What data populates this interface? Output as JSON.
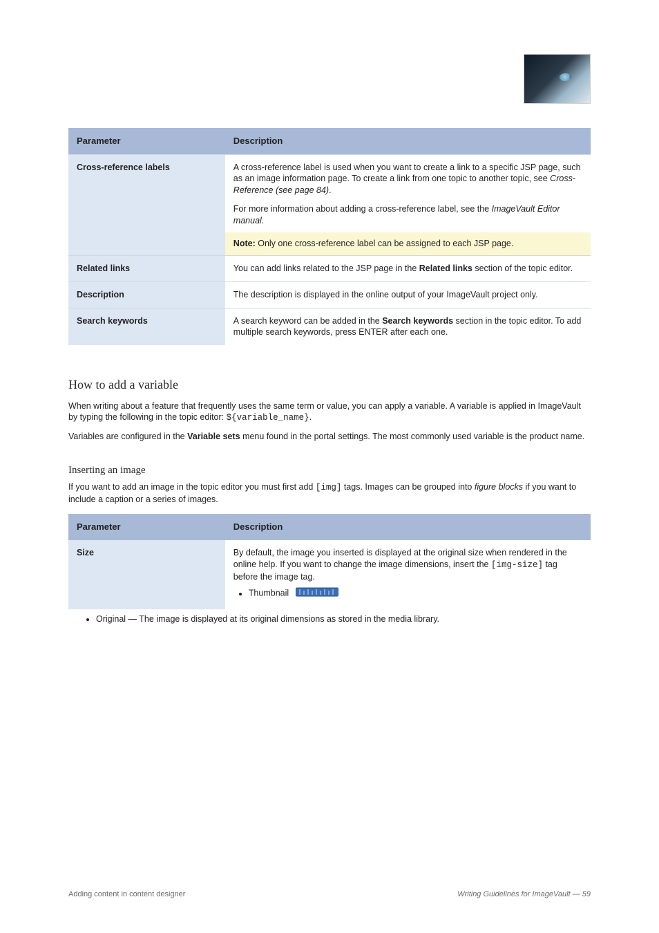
{
  "table1": {
    "headers": [
      "Parameter",
      "Description"
    ],
    "rows": [
      {
        "param": "Cross-reference labels",
        "desc_lead": "A cross-reference label is used when you want to create a link to a specific JSP page, such as an image information page. To create a link from one topic to another topic, see ",
        "xref_link": "Cross-Reference (see page 84)",
        "desc_tail": ".",
        "sub_lead": "For more information about adding a cross-reference label, see the ",
        "sub_link": "ImageVault Editor manual",
        "sub_tail": ".",
        "note_label": "Note:",
        "note_text": " Only one cross-reference label can be assigned to each JSP page."
      },
      {
        "param": "Related links",
        "desc_lead": "You can add links related to the JSP page in the ",
        "desc_bold": "Related links",
        "desc_tail": " section of the topic editor."
      },
      {
        "param": "Description",
        "desc": "The description is displayed in the online output of your ImageVault project only."
      },
      {
        "param": "Search keywords",
        "desc_lead": "A search keyword can be added in the ",
        "desc_bold": "Search keywords",
        "desc_tail2": " section in the topic editor. To add multiple search keywords, press ",
        "desc_key": "ENTER",
        "desc_tail3": " after each one."
      }
    ]
  },
  "section": {
    "heading": "How to add a variable",
    "p1_lead": "When writing about a feature that frequently uses the same term or value, you can apply a variable. A variable is applied in ImageVault by typing the following in the topic editor: ",
    "p1_code": "${variable_name}",
    "p1_tail": ".",
    "p2_lead": "Variables are configured in the ",
    "p2_bold": "Variable sets",
    "p2_tail": " menu found in the portal settings. The most commonly used variable is the product name.",
    "sub_heading": "Inserting an image",
    "p3_lead": "If you want to add an image in the topic editor you must first add ",
    "p3_code": "[img]",
    "p3_mid": " tags. Images can be grouped into ",
    "p3_em": "figure blocks",
    "p3_tail": " if you want to include a caption or a series of images."
  },
  "table2": {
    "headers": [
      "Parameter",
      "Description"
    ],
    "row": {
      "param": "Size",
      "desc_lead_1": "By default, the image you inserted is displayed at the original size when rendered in the online help. If you want to change the image dimensions, insert the ",
      "desc_code": "[img-size]",
      "desc_lead_2": " tag before the image tag.",
      "thumb_lead": "Thumbnail "
    }
  },
  "outer_bullet": "Original — The image is displayed at its original dimensions as stored in the media library.",
  "ruler_icon_name": "ruler-icon",
  "footer": {
    "left": "Adding content in content designer",
    "right": "Writing Guidelines for ImageVault — 59"
  }
}
